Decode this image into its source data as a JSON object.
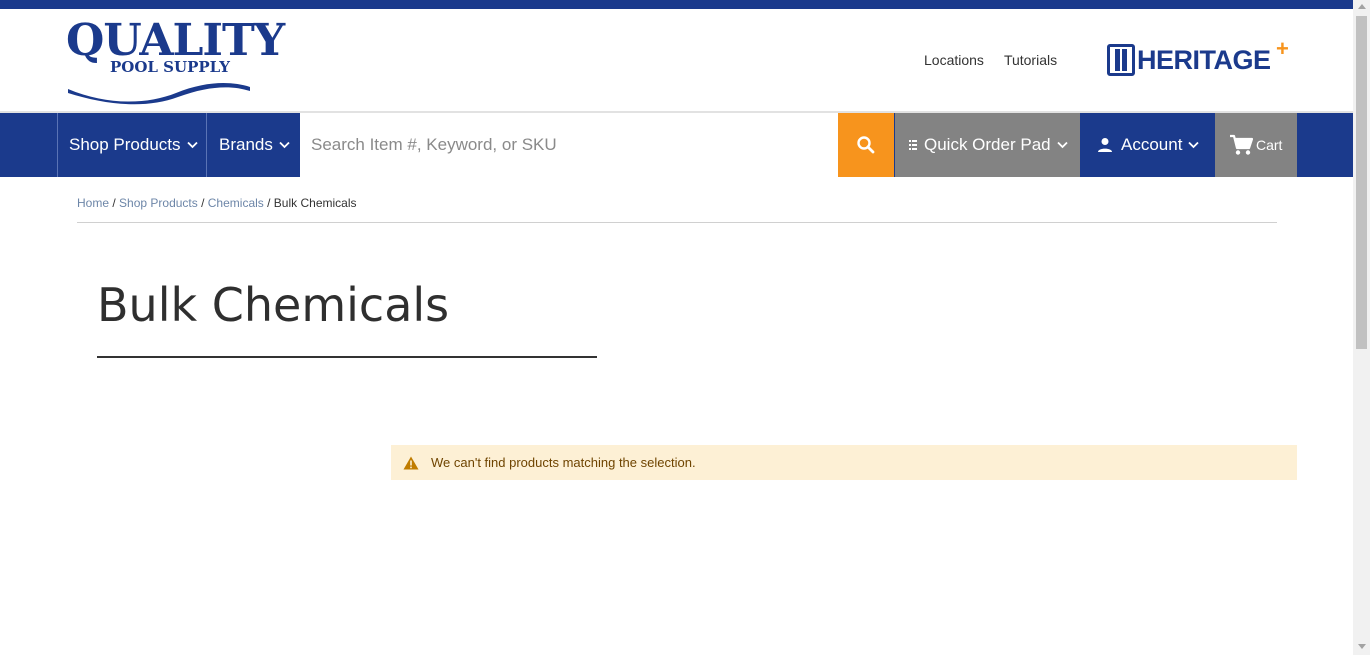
{
  "header": {
    "logo": {
      "line1": "QUALITY",
      "line2": "POOL SUPPLY"
    },
    "util_links": [
      "Locations",
      "Tutorials"
    ],
    "partner_logo": {
      "name": "HERITAGE",
      "plus": "+"
    }
  },
  "nav": {
    "shop_products": "Shop Products",
    "brands": "Brands",
    "search_placeholder": "Search Item #, Keyword, or SKU",
    "quick_order_pad": "Quick Order Pad",
    "account": "Account",
    "cart": "Cart"
  },
  "breadcrumb": {
    "items": [
      "Home",
      "Shop Products",
      "Chemicals"
    ],
    "separator": "/",
    "current": "Bulk Chemicals"
  },
  "page": {
    "title": "Bulk Chemicals",
    "notice": "We can't find products matching the selection."
  },
  "colors": {
    "brand_blue": "#1b3a8c",
    "accent_orange": "#f7941d",
    "gray_button": "#838383",
    "notice_bg": "#fdf0d5",
    "notice_text": "#6f4400"
  }
}
